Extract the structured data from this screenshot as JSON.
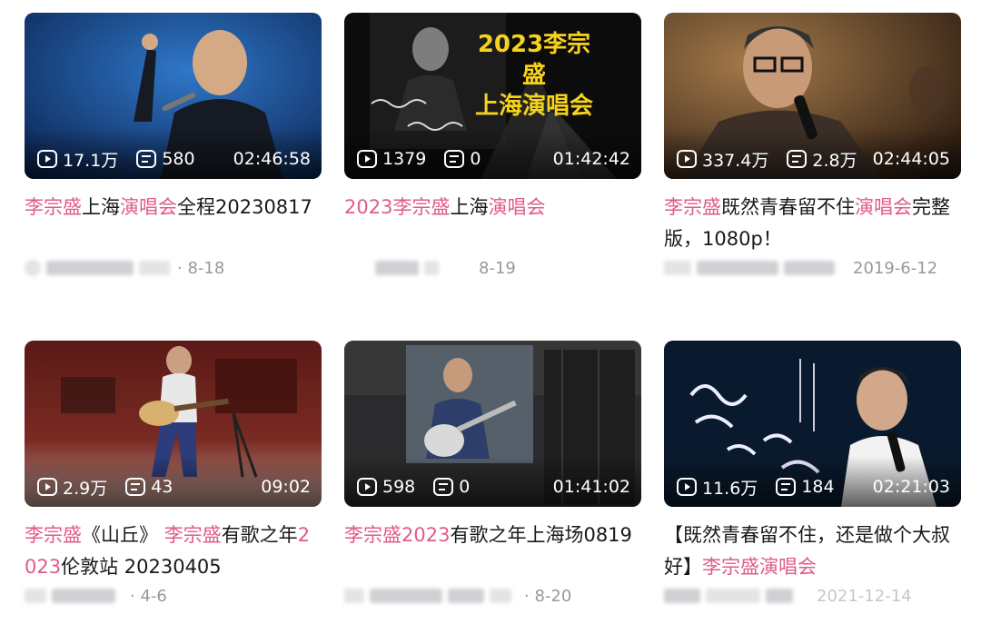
{
  "videos": [
    {
      "title_segments": [
        {
          "text": "李宗盛",
          "hl": true
        },
        {
          "text": "上海",
          "hl": false
        },
        {
          "text": "演唱会",
          "hl": true
        },
        {
          "text": "全程20230817",
          "hl": false
        }
      ],
      "views": "17.1万",
      "comments": "580",
      "duration": "02:46:58",
      "date": "· 8-18"
    },
    {
      "title_segments": [
        {
          "text": "2023李宗盛",
          "hl": true
        },
        {
          "text": "上海",
          "hl": false
        },
        {
          "text": "演唱会",
          "hl": true
        }
      ],
      "thumb_text": "2023李宗盛\n上海演唱会",
      "views": "1379",
      "comments": "0",
      "duration": "01:42:42",
      "date": "8-19"
    },
    {
      "title_segments": [
        {
          "text": "李宗盛",
          "hl": true
        },
        {
          "text": "既然青春留不住",
          "hl": false
        },
        {
          "text": "演唱会",
          "hl": true
        },
        {
          "text": "完整版，1080p！",
          "hl": false
        }
      ],
      "views": "337.4万",
      "comments": "2.8万",
      "duration": "02:44:05",
      "date": "2019-6-12"
    },
    {
      "title_segments": [
        {
          "text": "李宗盛",
          "hl": true
        },
        {
          "text": "《山丘》 ",
          "hl": false
        },
        {
          "text": "李宗盛",
          "hl": true
        },
        {
          "text": "有歌之年",
          "hl": false
        },
        {
          "text": "2023",
          "hl": true
        },
        {
          "text": "伦敦站 20230405",
          "hl": false
        }
      ],
      "views": "2.9万",
      "comments": "43",
      "duration": "09:02",
      "date": "· 4-6"
    },
    {
      "title_segments": [
        {
          "text": "李宗盛2023",
          "hl": true
        },
        {
          "text": "有歌之年上海场0819",
          "hl": false
        }
      ],
      "views": "598",
      "comments": "0",
      "duration": "01:41:02",
      "date": "· 8-20"
    },
    {
      "title_segments": [
        {
          "text": "【既然青春留不住，还是做个大叔好】",
          "hl": false
        },
        {
          "text": "李宗盛演唱会",
          "hl": true
        }
      ],
      "views": "11.6万",
      "comments": "184",
      "duration": "02:21:03",
      "date": "2021-12-14"
    }
  ],
  "icons": {
    "views": "play-count-icon",
    "comments": "danmaku-icon"
  },
  "colors": {
    "highlight": "#e05c85",
    "text": "#18191c",
    "meta": "#9499a0"
  }
}
